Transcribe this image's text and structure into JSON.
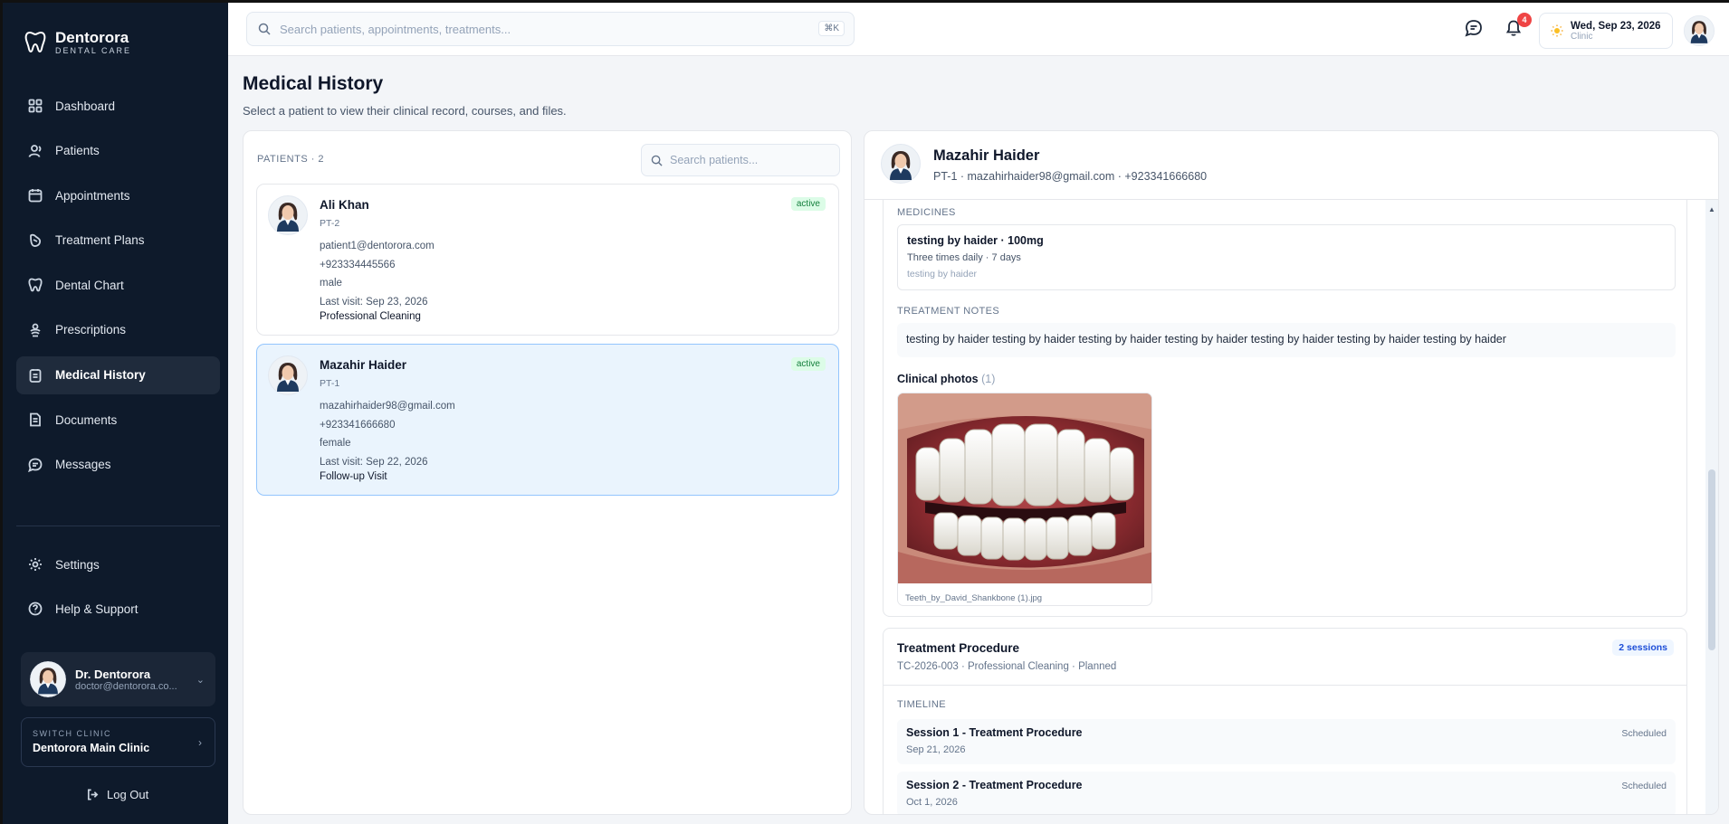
{
  "brand": {
    "name": "Dentorora",
    "subtitle": "DENTAL CARE"
  },
  "nav": {
    "items": [
      {
        "label": "Dashboard",
        "icon": "grid-icon"
      },
      {
        "label": "Patients",
        "icon": "user-icon"
      },
      {
        "label": "Appointments",
        "icon": "calendar-icon"
      },
      {
        "label": "Treatment Plans",
        "icon": "clipboard-icon"
      },
      {
        "label": "Dental Chart",
        "icon": "tooth-icon"
      },
      {
        "label": "Prescriptions",
        "icon": "rx-icon"
      },
      {
        "label": "Medical History",
        "icon": "history-icon",
        "active": true
      },
      {
        "label": "Documents",
        "icon": "document-icon"
      },
      {
        "label": "Messages",
        "icon": "message-icon"
      }
    ],
    "settings": "Settings",
    "help": "Help & Support"
  },
  "profile": {
    "name": "Dr. Dentorora",
    "email": "doctor@dentorora.co..."
  },
  "clinic": {
    "label": "SWITCH CLINIC",
    "name": "Dentorora Main Clinic"
  },
  "logout": "Log Out",
  "header": {
    "search_placeholder": "Search patients, appointments, treatments...",
    "shortcut": "⌘K",
    "notifications": "4",
    "date": "Wed, Sep 23, 2026",
    "location": "Clinic"
  },
  "page": {
    "title": "Medical History",
    "subtitle": "Select a patient to view their clinical record, courses, and files."
  },
  "patients_panel": {
    "heading": "PATIENTS · 2",
    "search_placeholder": "Search patients...",
    "patients": [
      {
        "name": "Ali Khan",
        "id": "PT-2",
        "email": "patient1@dentorora.com",
        "phone": "+923334445566",
        "gender": "male",
        "last_visit": "Last visit: Sep 23, 2026",
        "procedure": "Professional Cleaning",
        "status": "active"
      },
      {
        "name": "Mazahir Haider",
        "id": "PT-1",
        "email": "mazahirhaider98@gmail.com",
        "phone": "+923341666680",
        "gender": "female",
        "last_visit": "Last visit: Sep 22, 2026",
        "procedure": "Follow-up Visit",
        "status": "active"
      }
    ]
  },
  "detail": {
    "name": "Mazahir Haider",
    "meta": "PT-1 · mazahirhaider98@gmail.com · +923341666680",
    "medicines_label": "MEDICINES",
    "medicine": {
      "title": "testing by haider · 100mg",
      "schedule": "Three times daily · 7 days",
      "note": "testing by haider"
    },
    "notes_label": "TREATMENT NOTES",
    "notes": "testing by haider testing by haider testing by haider testing by haider testing by haider testing by haider testing by haider",
    "photos_label": "Clinical photos",
    "photos_count": "(1)",
    "photo_filename": "Teeth_by_David_Shankbone (1).jpg",
    "procedure": {
      "title": "Treatment Procedure",
      "meta": "TC-2026-003 · Professional Cleaning · Planned",
      "sessions_badge": "2 sessions",
      "timeline_label": "TIMELINE",
      "sessions": [
        {
          "title": "Session 1 - Treatment Procedure",
          "date": "Sep 21, 2026",
          "status": "Scheduled"
        },
        {
          "title": "Session 2 - Treatment Procedure",
          "date": "Oct 1, 2026",
          "status": "Scheduled"
        }
      ]
    }
  }
}
